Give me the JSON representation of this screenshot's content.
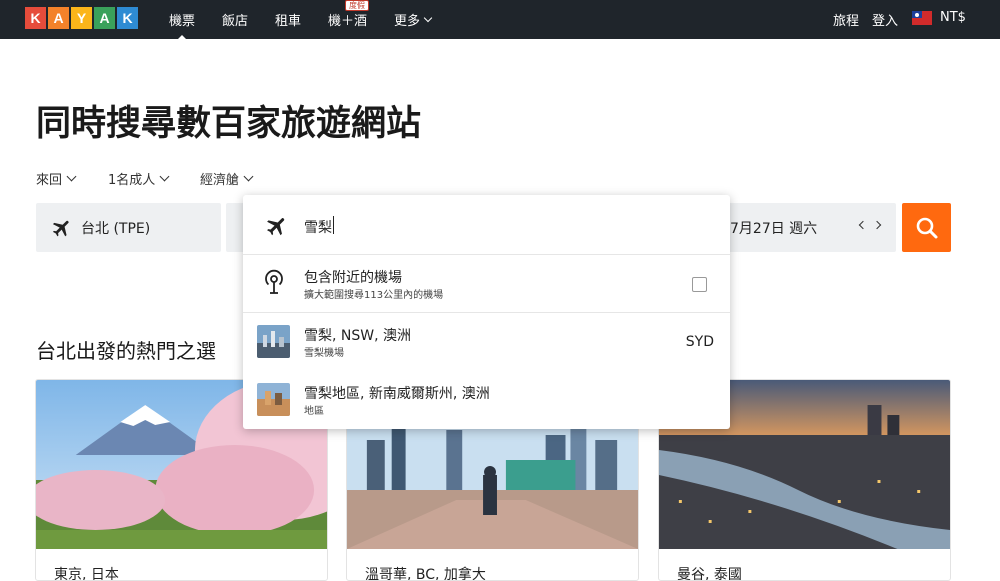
{
  "nav": {
    "logo_letters": [
      "K",
      "A",
      "Y",
      "A",
      "K"
    ],
    "logo_colors": [
      "#e64c3b",
      "#f3822a",
      "#fbb51a",
      "#3aa15b",
      "#2e8bd3"
    ],
    "items": [
      {
        "label": "機票"
      },
      {
        "label": "飯店"
      },
      {
        "label": "租車"
      },
      {
        "label": "機＋酒"
      },
      {
        "label": "更多"
      }
    ],
    "deal_badge": "度假",
    "trips": "旅程",
    "login": "登入",
    "currency": "NT$"
  },
  "headline": "同時搜尋數百家旅遊網站",
  "options": {
    "trip_type": "來回",
    "travelers": "1名成人",
    "cabin": "經濟艙"
  },
  "search": {
    "origin": "台北 (TPE)",
    "date": "7月27日 週六",
    "accent_color": "#ff690f"
  },
  "dropdown": {
    "query": "雪梨",
    "nearby": {
      "title": "包含附近的機場",
      "subtitle": "擴大範圍搜尋113公里內的機場"
    },
    "results": [
      {
        "title": "雪梨, NSW, 澳洲",
        "subtitle": "雪梨機場",
        "code": "SYD"
      },
      {
        "title": "雪梨地區, 新南威爾斯州, 澳洲",
        "subtitle": "地區",
        "code": ""
      }
    ]
  },
  "popular": {
    "title": "台北出發的熱門之選",
    "destinations": [
      {
        "city": "東京, 日本"
      },
      {
        "city": "溫哥華, BC, 加拿大"
      },
      {
        "city": "曼谷, 泰國"
      }
    ]
  }
}
